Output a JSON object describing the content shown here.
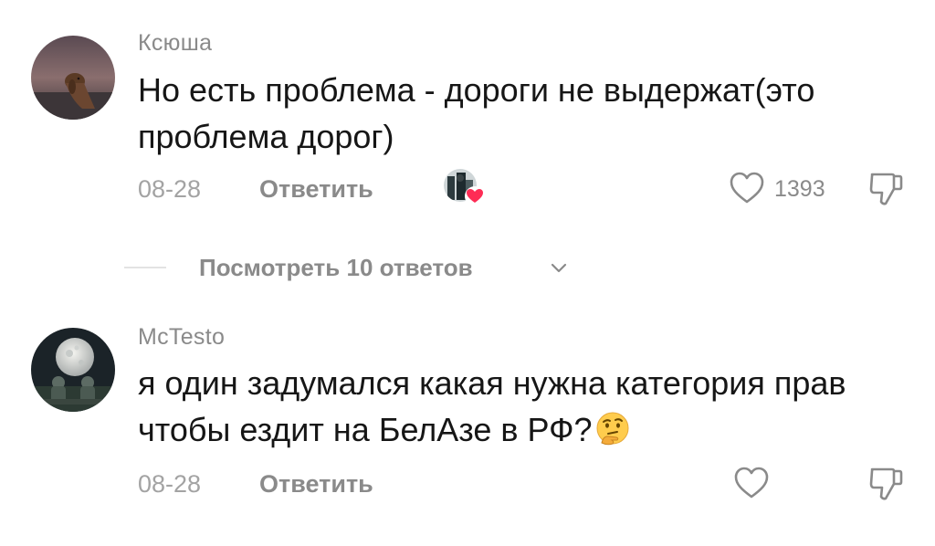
{
  "comments": [
    {
      "username": "Ксюша",
      "text": "Но есть проблема - дороги не выдержат(это проблема дорог)",
      "date": "08-28",
      "reply_label": "Ответить",
      "like_count": "1393",
      "liked_by_creator": true,
      "avatar_icon": "dog-silhouette-avatar"
    },
    {
      "username": "McTesto",
      "text": "я один задумался какая нужна категория прав чтобы ездит на БелАзе в РФ?",
      "emoji": "thinking-face-emoji",
      "date": "08-28",
      "reply_label": "Ответить",
      "like_count": "",
      "liked_by_creator": false,
      "avatar_icon": "moon-astronauts-avatar"
    }
  ],
  "view_replies": {
    "label": "Посмотреть 10 ответов"
  },
  "colors": {
    "text": "#161616",
    "secondary": "#8a8a8a",
    "date": "#a3a3a3",
    "heart_red": "#fe2c55"
  }
}
